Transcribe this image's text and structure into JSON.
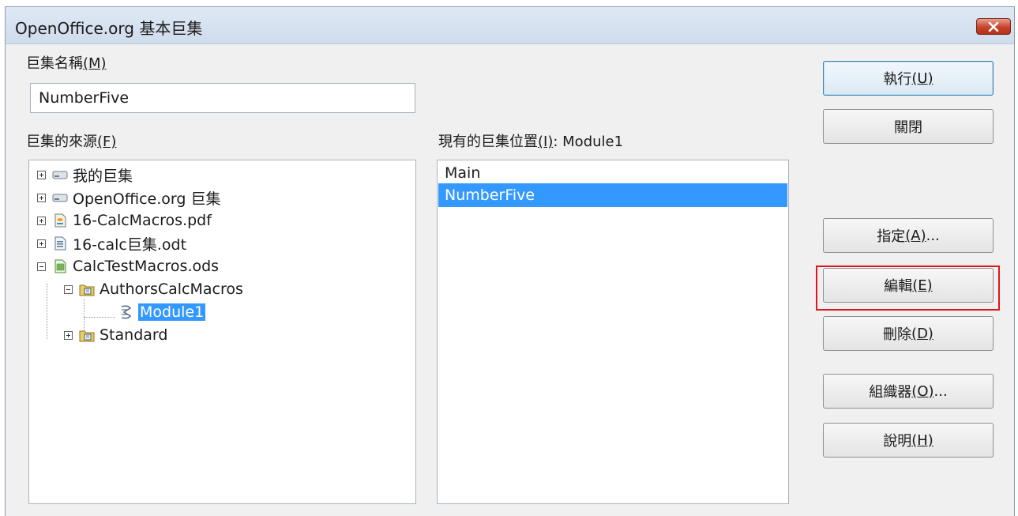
{
  "window": {
    "title": "OpenOffice.org 基本巨集"
  },
  "macro_name": {
    "label": "巨集名稱",
    "mnemonic": "(M)",
    "value": "NumberFive"
  },
  "macro_source": {
    "label": "巨集的來源",
    "mnemonic": "(F)",
    "tree": [
      {
        "label": "我的巨集",
        "icon": "drive-icon",
        "expander": "plus",
        "selected": false
      },
      {
        "label": "OpenOffice.org 巨集",
        "icon": "drive-icon",
        "expander": "plus",
        "selected": false
      },
      {
        "label": "16-CalcMacros.pdf",
        "icon": "document-icon",
        "expander": "plus",
        "selected": false
      },
      {
        "label": "16-calc巨集.odt",
        "icon": "writer-document-icon",
        "expander": "plus",
        "selected": false
      },
      {
        "label": "CalcTestMacros.ods",
        "icon": "spreadsheet-icon",
        "expander": "minus",
        "selected": false
      },
      {
        "label": "AuthorsCalcMacros",
        "icon": "library-folder-icon",
        "expander": "minus",
        "selected": false
      },
      {
        "label": "Module1",
        "icon": "module-icon",
        "expander": "",
        "selected": true
      },
      {
        "label": "Standard",
        "icon": "library-folder-icon",
        "expander": "plus",
        "selected": false
      }
    ]
  },
  "existing_macros": {
    "label": "現有的巨集位置",
    "mnemonic": "(I)",
    "location": ": Module1",
    "items": [
      {
        "label": "Main",
        "selected": false
      },
      {
        "label": "NumberFive",
        "selected": true
      }
    ]
  },
  "buttons": {
    "run": {
      "label": "執行",
      "mnemonic": "(U)"
    },
    "close": {
      "label": "關閉"
    },
    "assign": {
      "label": "指定",
      "mnemonic": "(A)",
      "suffix": "..."
    },
    "edit": {
      "label": "編輯",
      "mnemonic": "(E)"
    },
    "delete": {
      "label": "刪除",
      "mnemonic": "(D)"
    },
    "organizer": {
      "label": "組織器",
      "mnemonic": "(O)",
      "suffix": "..."
    },
    "help": {
      "label": "說明",
      "mnemonic": "(H)"
    }
  },
  "colors": {
    "selection": "#3399ff",
    "highlight_box": "#e0161a",
    "close_button": "#c7432b"
  }
}
